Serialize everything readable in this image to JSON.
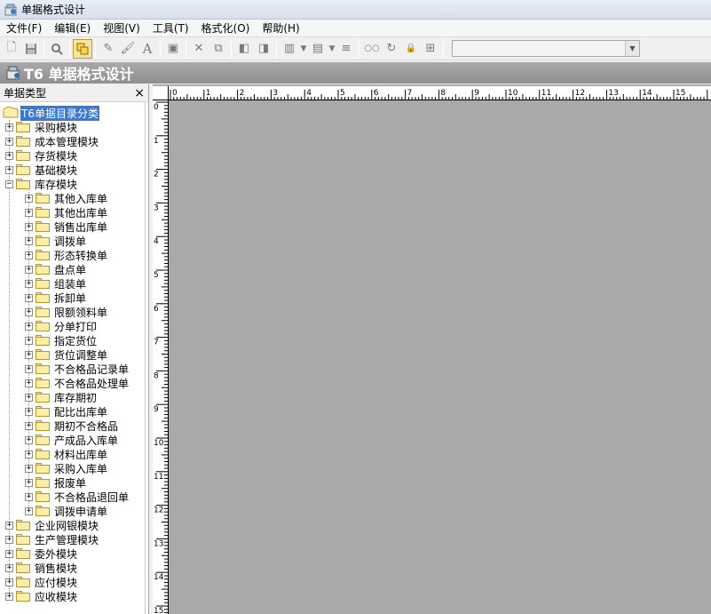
{
  "window": {
    "title": "单据格式设计"
  },
  "menu": [
    "文件(F)",
    "编辑(E)",
    "视图(V)",
    "工具(T)",
    "格式化(O)",
    "帮助(H)"
  ],
  "toolbar": {
    "buttons": [
      "new-icon",
      "save-icon",
      "preview-icon",
      "copy-format-icon",
      "paint-icon",
      "fill-icon",
      "text-icon",
      "properties-icon",
      "delete-icon",
      "copy-icon",
      "align-left-icon",
      "align-right-icon",
      "chart-icon",
      "table-icon",
      "lines-icon",
      "link-icon",
      "refresh-icon",
      "lock-icon",
      "grid-icon"
    ],
    "select_value": ""
  },
  "banner": {
    "title": "T6 单据格式设计"
  },
  "panel": {
    "title": "单据类型",
    "close_label": "×",
    "root": "T6单据目录分类",
    "top_items": [
      "采购模块",
      "成本管理模块",
      "存货模块",
      "基础模块"
    ],
    "expanded_item": "库存模块",
    "children": [
      "其他入库单",
      "其他出库单",
      "销售出库单",
      "调拨单",
      "形态转换单",
      "盘点单",
      "组装单",
      "拆卸单",
      "限额领料单",
      "分单打印",
      "指定货位",
      "货位调整单",
      "不合格品记录单",
      "不合格品处理单",
      "库存期初",
      "配比出库单",
      "期初不合格品",
      "产成品入库单",
      "材料出库单",
      "采购入库单",
      "报废单",
      "不合格品退回单",
      "调拨申请单"
    ],
    "bottom_items": [
      "企业网银模块",
      "生产管理模块",
      "委外模块",
      "销售模块",
      "应付模块",
      "应收模块"
    ]
  },
  "ruler": {
    "top_labels": [
      "0",
      "1",
      "2",
      "3",
      "4",
      "5",
      "6",
      "7",
      "8",
      "9",
      "10",
      "11",
      "12",
      "13",
      "14",
      "15"
    ],
    "left_labels": [
      "0",
      "1",
      "2",
      "3",
      "4",
      "5",
      "6",
      "7",
      "8",
      "9",
      "10",
      "11",
      "12",
      "13",
      "14",
      "15"
    ]
  }
}
